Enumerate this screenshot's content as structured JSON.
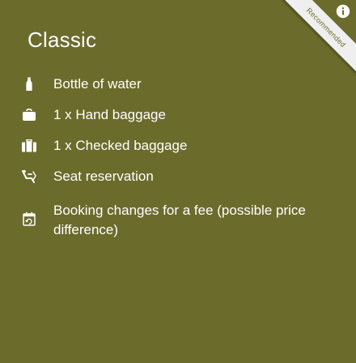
{
  "fare": {
    "title": "Classic",
    "badge": "Recommended",
    "info_label": "i"
  },
  "features": [
    {
      "icon": "water-bottle-icon",
      "label": "Bottle of water"
    },
    {
      "icon": "hand-baggage-icon",
      "label": "1 x Hand baggage"
    },
    {
      "icon": "checked-baggage-icon",
      "label": "1 x Checked baggage"
    },
    {
      "icon": "seat-reservation-icon",
      "label": "Seat reservation"
    },
    {
      "icon": "booking-changes-icon",
      "label": "Booking changes for a fee (possible price difference)"
    }
  ],
  "colors": {
    "background": "#6b6b2c",
    "text": "#ffffff",
    "ribbon": "#efefef"
  }
}
